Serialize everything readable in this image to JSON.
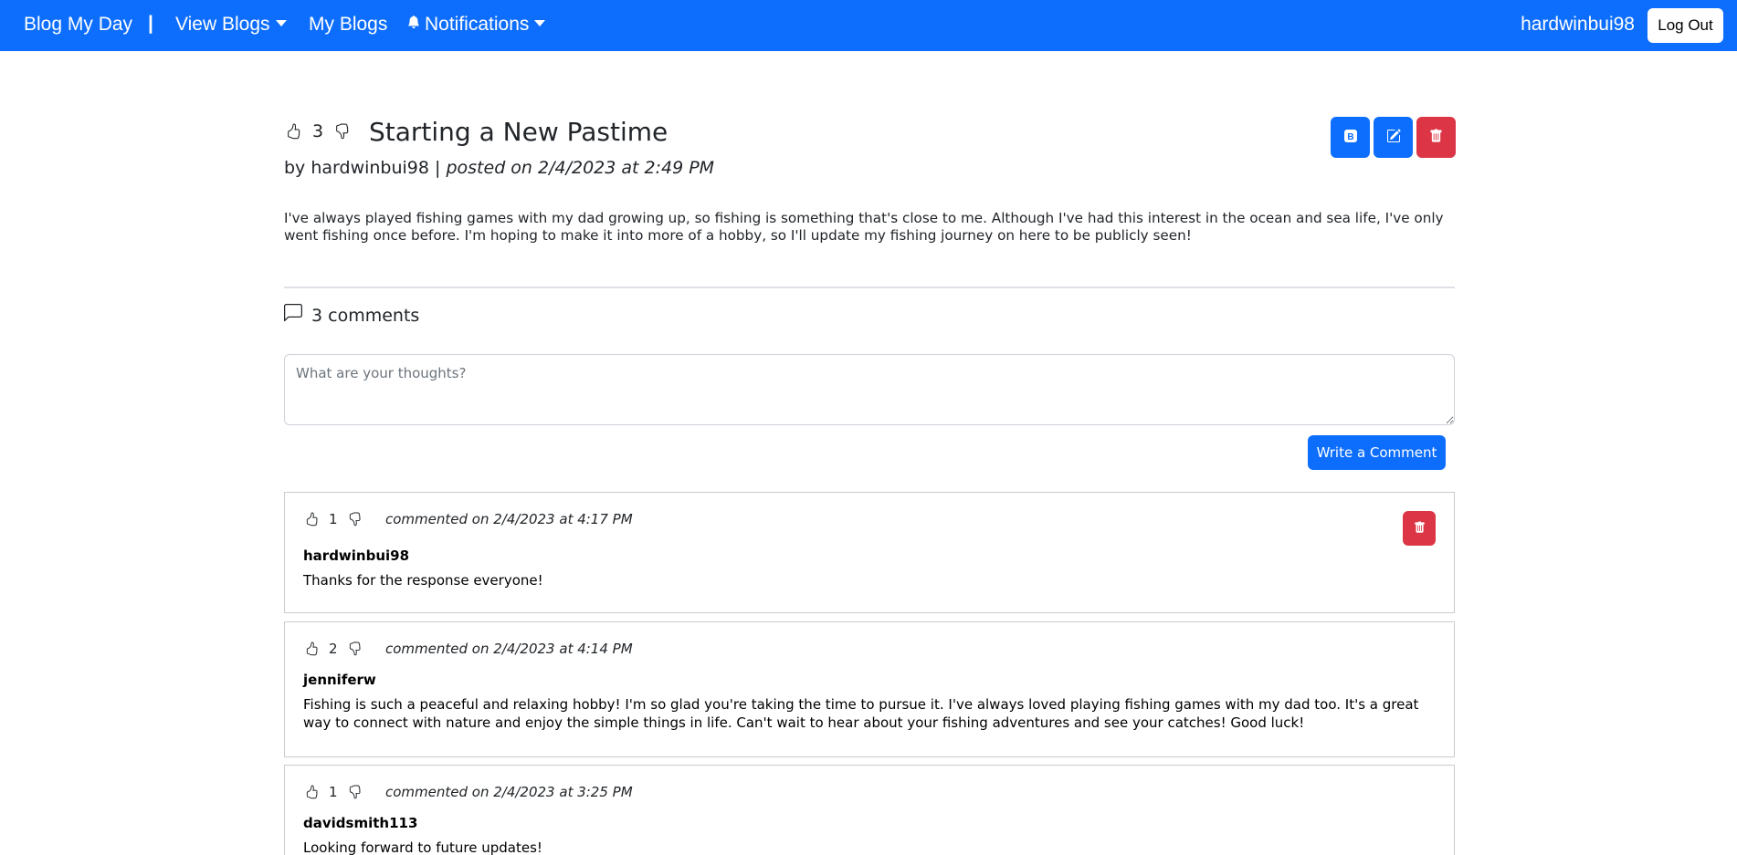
{
  "navbar": {
    "brand": "Blog My Day",
    "separator": "|",
    "view_blogs": "View Blogs",
    "my_blogs": "My Blogs",
    "notifications": "Notifications",
    "username": "hardwinbui98",
    "logout": "Log Out",
    "color": "#0d6efd"
  },
  "post": {
    "likes": "3",
    "title": "Starting a New Pastime",
    "author_prefix": "by hardwinbui98 | ",
    "posted": "posted on 2/4/2023 at 2:49 PM",
    "body": "I've always played fishing games with my dad growing up, so fishing is something that's close to me. Although I've had this interest in the ocean and sea life, I've only went fishing once before. I'm hoping to make it into more of a hobby, so I'll update my fishing journey on here to be publicly seen!",
    "actions": [
      "bootstrap-icon",
      "edit-icon",
      "trash-icon"
    ]
  },
  "comments_section": {
    "count_label": "3 comments",
    "placeholder": "What are your thoughts?",
    "submit_label": "Write a Comment"
  },
  "comments": [
    {
      "likes": "1",
      "date": "commented on 2/4/2023 at 4:17 PM",
      "author": "hardwinbui98",
      "text": "Thanks for the response everyone!"
    },
    {
      "likes": "2",
      "date": "commented on 2/4/2023 at 4:14 PM",
      "author": "jenniferw",
      "text": "Fishing is such a peaceful and relaxing hobby! I'm so glad you're taking the time to pursue it. I've always loved playing fishing games with my dad too. It's a great way to connect with nature and enjoy the simple things in life. Can't wait to hear about your fishing adventures and see your catches! Good luck!"
    },
    {
      "likes": "1",
      "date": "commented on 2/4/2023 at 3:25 PM",
      "author": "davidsmith113",
      "text": "Looking forward to future updates!"
    }
  ]
}
